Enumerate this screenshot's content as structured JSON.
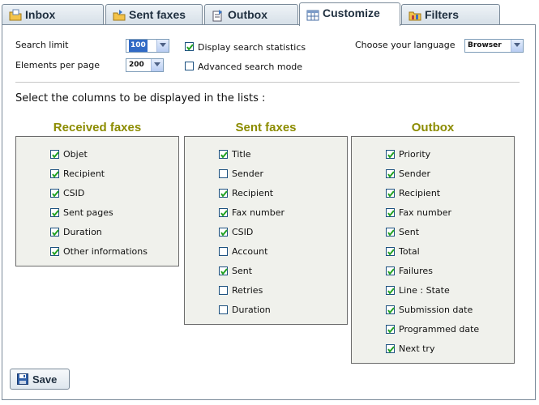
{
  "tabs": [
    {
      "label": "Inbox",
      "icon": "inbox-folder-icon",
      "active": false
    },
    {
      "label": "Sent faxes",
      "icon": "sent-folder-icon",
      "active": false
    },
    {
      "label": "Outbox",
      "icon": "outbox-icon",
      "active": false
    },
    {
      "label": "Customize",
      "icon": "customize-table-icon",
      "active": true
    },
    {
      "label": "Filters",
      "icon": "filters-folder-icon",
      "active": false
    }
  ],
  "settings": {
    "search_limit_label": "Search limit",
    "search_limit_value": "100",
    "elements_per_page_label": "Elements per page",
    "elements_per_page_value": "200",
    "display_stats_label": "Display search statistics",
    "display_stats_checked": true,
    "advanced_mode_label": "Advanced search mode",
    "advanced_mode_checked": false,
    "language_label": "Choose your language",
    "language_value": "Browser"
  },
  "instructions": "Select the columns to be displayed in the lists :",
  "groups": [
    {
      "title": "Received faxes",
      "items": [
        {
          "label": "Objet",
          "checked": true
        },
        {
          "label": "Recipient",
          "checked": true
        },
        {
          "label": "CSID",
          "checked": true
        },
        {
          "label": "Sent pages",
          "checked": true
        },
        {
          "label": "Duration",
          "checked": true
        },
        {
          "label": "Other informations",
          "checked": true
        }
      ]
    },
    {
      "title": "Sent faxes",
      "items": [
        {
          "label": "Title",
          "checked": true
        },
        {
          "label": "Sender",
          "checked": false
        },
        {
          "label": "Recipient",
          "checked": true
        },
        {
          "label": "Fax number",
          "checked": true
        },
        {
          "label": "CSID",
          "checked": true
        },
        {
          "label": "Account",
          "checked": false
        },
        {
          "label": "Sent",
          "checked": true
        },
        {
          "label": "Retries",
          "checked": false
        },
        {
          "label": "Duration",
          "checked": false
        }
      ]
    },
    {
      "title": "Outbox",
      "items": [
        {
          "label": "Priority",
          "checked": true
        },
        {
          "label": "Sender",
          "checked": true
        },
        {
          "label": "Recipient",
          "checked": true
        },
        {
          "label": "Fax number",
          "checked": true
        },
        {
          "label": "Sent",
          "checked": true
        },
        {
          "label": "Total",
          "checked": true
        },
        {
          "label": "Failures",
          "checked": true
        },
        {
          "label": "Line : State",
          "checked": true
        },
        {
          "label": "Submission date",
          "checked": true
        },
        {
          "label": "Programmed date",
          "checked": true
        },
        {
          "label": "Next try",
          "checked": true
        }
      ]
    }
  ],
  "save_button": {
    "label": "Save",
    "icon": "floppy-disk-icon"
  },
  "colors": {
    "group_title": "#8c8c00",
    "group_bg": "#f0f1ec",
    "accent_select": "#316ac5"
  }
}
